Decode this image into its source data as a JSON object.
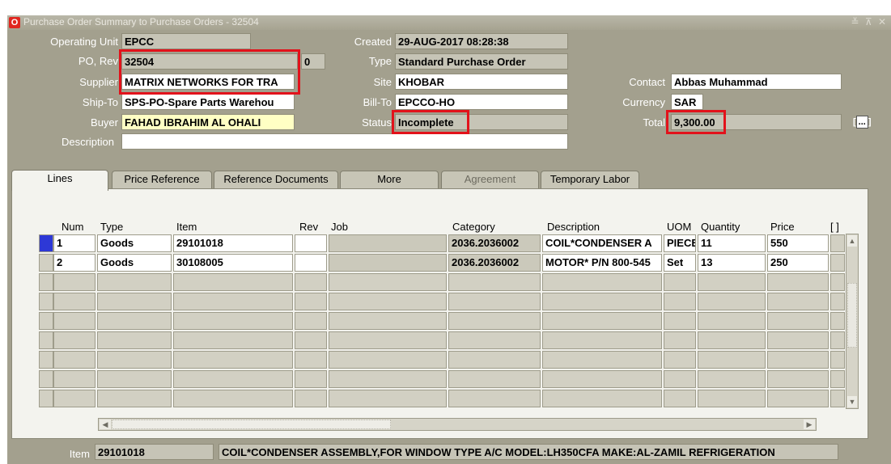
{
  "window": {
    "title": "Purchase Order Summary to Purchase Orders - 32504",
    "controls": "≚ ⊼ ✕"
  },
  "header": {
    "operating_unit_label": "Operating Unit",
    "operating_unit": "EPCC",
    "po_rev_label": "PO, Rev",
    "po_number": "32504",
    "revision": "0",
    "supplier_label": "Supplier",
    "supplier": "MATRIX NETWORKS FOR TRA",
    "ship_to_label": "Ship-To",
    "ship_to": "SPS-PO-Spare Parts Warehou",
    "buyer_label": "Buyer",
    "buyer": "FAHAD IBRAHIM AL OHALI",
    "description_label": "Description",
    "description": "",
    "created_label": "Created",
    "created": "29-AUG-2017 08:28:38",
    "type_label": "Type",
    "type": "Standard Purchase Order",
    "site_label": "Site",
    "site": "KHOBAR",
    "bill_to_label": "Bill-To",
    "bill_to": "EPCCO-HO",
    "status_label": "Status",
    "status": "Incomplete",
    "contact_label": "Contact",
    "contact": "Abbas Muhammad",
    "currency_label": "Currency",
    "currency": "SAR",
    "total_label": "Total",
    "total": "9,300.00",
    "lov_left": "[",
    "lov_btn": "...",
    "lov_right": "]"
  },
  "tabs": [
    {
      "label": "Lines"
    },
    {
      "label": "Price Reference"
    },
    {
      "label": "Reference Documents"
    },
    {
      "label": "More"
    },
    {
      "label": "Agreement"
    },
    {
      "label": "Temporary Labor"
    }
  ],
  "columns": [
    "Num",
    "Type",
    "Item",
    "Rev",
    "Job",
    "Category",
    "Description",
    "UOM",
    "Quantity",
    "Price",
    "[ ]"
  ],
  "lines": [
    {
      "num": "1",
      "type": "Goods",
      "item": "29101018",
      "rev": "",
      "job": "",
      "category": "2036.2036002",
      "description": "COIL*CONDENSER A",
      "uom": "PIECE",
      "quantity": "11",
      "price": "550"
    },
    {
      "num": "2",
      "type": "Goods",
      "item": "30108005",
      "rev": "",
      "job": "",
      "category": "2036.2036002",
      "description": "MOTOR* P/N 800-545",
      "uom": "Set",
      "quantity": "13",
      "price": "250"
    }
  ],
  "footer": {
    "item_label": "Item",
    "item": "29101018",
    "item_description": "COIL*CONDENSER ASSEMBLY,FOR WINDOW TYPE A/C MODEL:LH350CFA MAKE:AL-ZAMIL REFRIGERATION"
  },
  "colors": {
    "highlight": "#e2121b",
    "window_bg": "#a3a08e",
    "selected_row": "#2d38d6",
    "buyer_field": "#ffffc4"
  }
}
